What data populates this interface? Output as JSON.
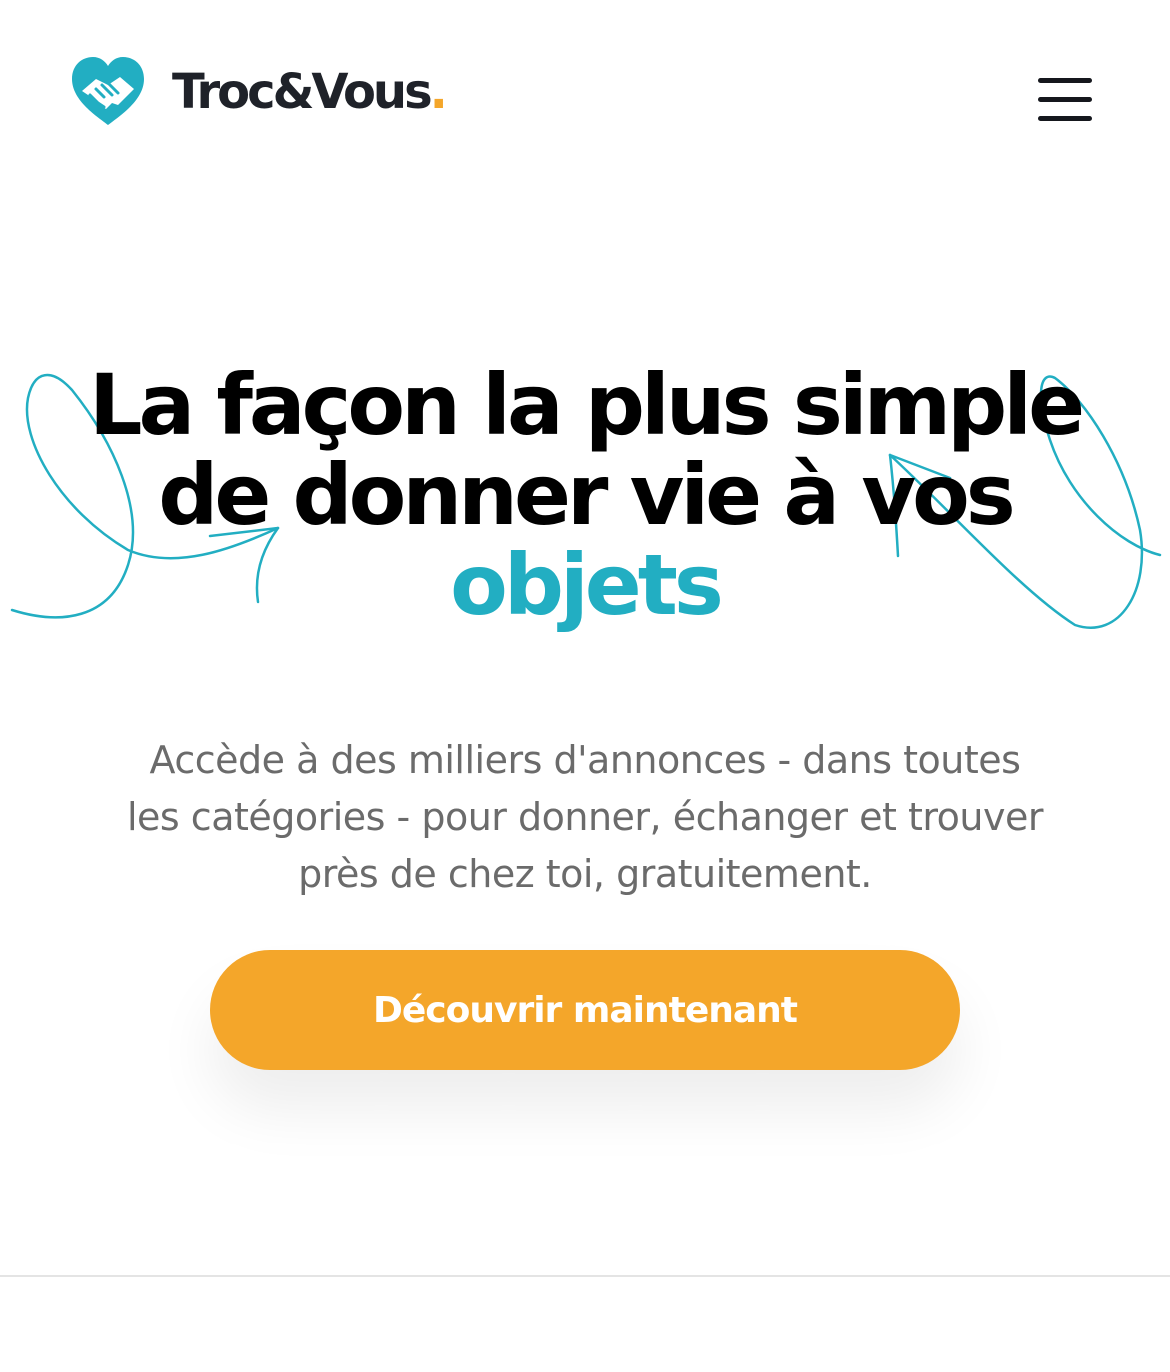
{
  "header": {
    "logo": {
      "brand_name": "Troc&Vous",
      "brand_dot": ".",
      "icon": "heart-handshake-icon"
    },
    "menu_icon": "hamburger-menu-icon"
  },
  "hero": {
    "title_lines": [
      "La façon la plus simple",
      "de donner vie à vos"
    ],
    "title_accent": "objets",
    "description_lines": [
      "Accède à des milliers d'annonces - dans toutes",
      "les catégories - pour donner, échanger et trouver",
      "près de chez toi, gratuitement."
    ],
    "cta_label": "Découvrir maintenant",
    "decorations": [
      "left-arrow-doodle",
      "right-arrow-doodle"
    ]
  },
  "colors": {
    "brand_teal": "#22aec2",
    "brand_orange": "#f4a62a",
    "text_dark": "#000000",
    "text_muted": "#6b6b6b",
    "background": "#ffffff"
  }
}
